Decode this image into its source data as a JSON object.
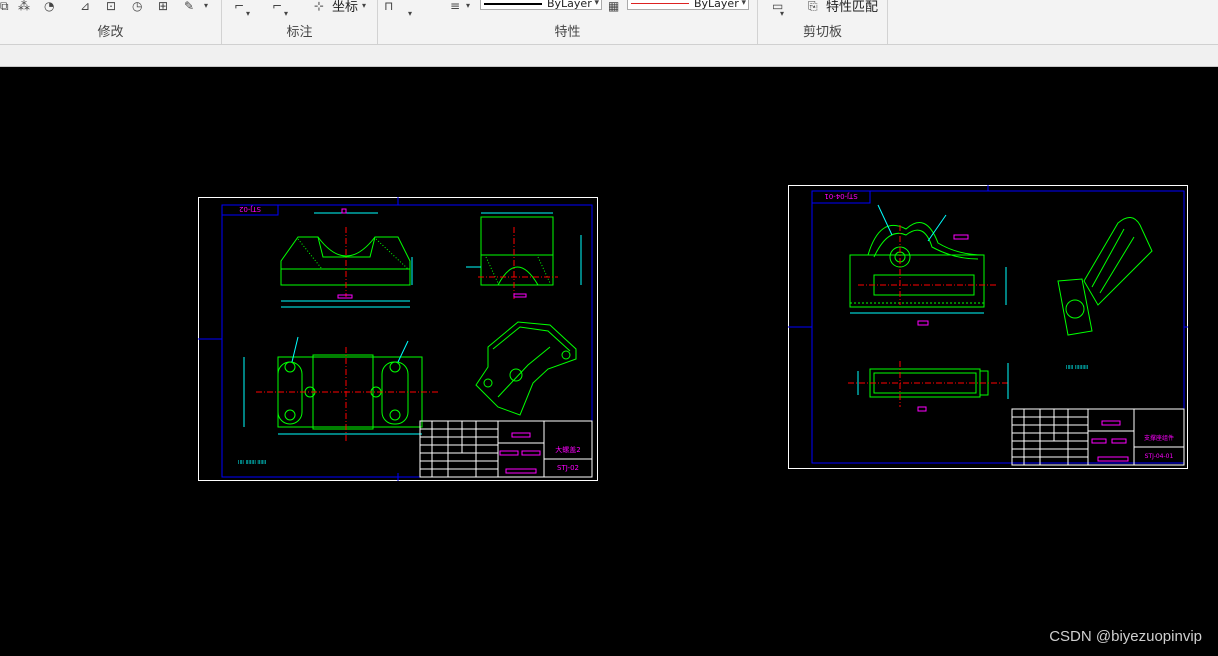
{
  "ribbon": {
    "panels": [
      {
        "label": "修改"
      },
      {
        "label": "标注"
      },
      {
        "label": "特性"
      },
      {
        "label": "剪切板"
      }
    ],
    "annotate": {
      "coordinate_label": "坐标"
    },
    "properties": {
      "linetype_value": "ByLayer",
      "color_value": "ByLayer"
    },
    "clipboard": {
      "match_properties_label": "特性匹配"
    }
  },
  "drawing_left": {
    "title_code_top": "STJ-02",
    "part_name": "大螺盖2",
    "drawing_no": "STJ-02",
    "border_color": "#0000ff",
    "outline_color": "#00ff00",
    "dimension_color": "#00ffff",
    "centerline_color": "#ff0000",
    "text_color": "#ff00ff"
  },
  "drawing_right": {
    "title_code_top": "STJ-04-01",
    "part_name": "支撑座组件",
    "drawing_no": "STJ-04-01"
  },
  "watermark": "CSDN @biyezuopinvip"
}
